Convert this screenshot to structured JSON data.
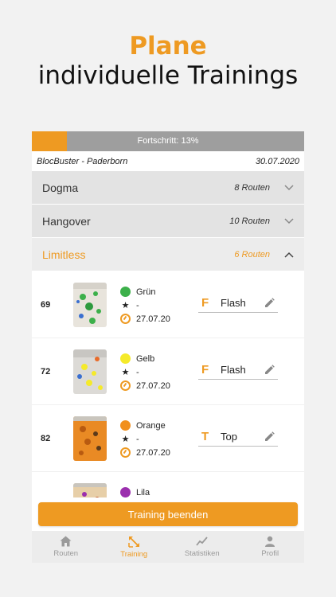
{
  "hero": {
    "title": "Plane",
    "subtitle": "individuelle Trainings"
  },
  "progress": {
    "label": "Fortschritt: 13%",
    "value": 0.13
  },
  "gym": {
    "name": "BlocBuster - Paderborn",
    "date": "30.07.2020"
  },
  "groups": [
    {
      "name": "Dogma",
      "count": "8 Routen",
      "expanded": false
    },
    {
      "name": "Hangover",
      "count": "10 Routen",
      "expanded": false
    },
    {
      "name": "Limitless",
      "count": "6 Routen",
      "expanded": true
    }
  ],
  "routes": [
    {
      "number": "69",
      "color_name": "Grün",
      "color": "#3cb04a",
      "rating": "-",
      "date": "27.07.20",
      "ascent_letter": "F",
      "ascent": "Flash"
    },
    {
      "number": "72",
      "color_name": "Gelb",
      "color": "#f5ea2a",
      "rating": "-",
      "date": "27.07.20",
      "ascent_letter": "F",
      "ascent": "Flash"
    },
    {
      "number": "82",
      "color_name": "Orange",
      "color": "#f1901e",
      "rating": "-",
      "date": "27.07.20",
      "ascent_letter": "T",
      "ascent": "Top"
    },
    {
      "number": "",
      "color_name": "Lila",
      "color": "#9b2fae",
      "rating": "",
      "date": "",
      "ascent_letter": "",
      "ascent": ""
    }
  ],
  "finish_button": "Training beenden",
  "tabs": [
    {
      "label": "Routen",
      "icon": "home-icon"
    },
    {
      "label": "Training",
      "icon": "expand-arrows-icon",
      "active": true
    },
    {
      "label": "Statistiken",
      "icon": "chart-line-icon"
    },
    {
      "label": "Profil",
      "icon": "person-icon"
    }
  ],
  "colors": {
    "accent": "#ee9a22",
    "progress_bg": "#9e9e9e",
    "group_bg": "#e3e3e3"
  }
}
